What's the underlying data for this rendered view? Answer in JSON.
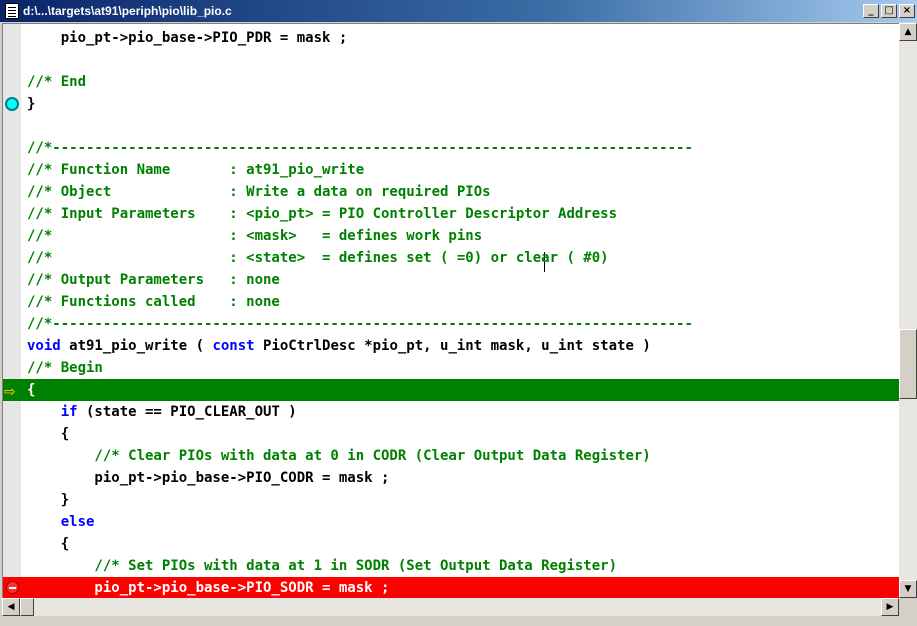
{
  "window": {
    "title": "d:\\...\\targets\\at91\\periph\\pio\\lib_pio.c"
  },
  "titlebar_buttons": {
    "minimize": "_",
    "maximize": "□",
    "close": "×"
  },
  "editor": {
    "lines": [
      {
        "text": "    pio_pt->pio_base->PIO_PDR = mask ;",
        "style": "code"
      },
      {
        "text": "",
        "style": "code"
      },
      {
        "text": "//* End",
        "style": "comment"
      },
      {
        "text": "}",
        "style": "code",
        "marker": "circle"
      },
      {
        "text": "",
        "style": "code"
      },
      {
        "text": "//*----------------------------------------------------------------------------",
        "style": "comment"
      },
      {
        "text": "//* Function Name       : at91_pio_write",
        "style": "comment"
      },
      {
        "text": "//* Object              : Write a data on required PIOs",
        "style": "comment"
      },
      {
        "text": "//* Input Parameters    : <pio_pt> = PIO Controller Descriptor Address",
        "style": "comment"
      },
      {
        "text": "//*                     : <mask>   = defines work pins",
        "style": "comment"
      },
      {
        "text": "//*                     : <state>  = defines set ( =0) or clear ( #0)",
        "style": "comment"
      },
      {
        "text": "//* Output Parameters   : none",
        "style": "comment"
      },
      {
        "text": "//* Functions called    : none",
        "style": "comment"
      },
      {
        "text": "//*----------------------------------------------------------------------------",
        "style": "comment"
      },
      {
        "segments": [
          {
            "t": "void",
            "s": "kw"
          },
          {
            "t": " at91_pio_write ( ",
            "s": "code"
          },
          {
            "t": "const",
            "s": "kw"
          },
          {
            "t": " PioCtrlDesc *pio_pt, u_int mask, u_int state )",
            "s": "code"
          }
        ]
      },
      {
        "text": "//* Begin",
        "style": "comment"
      },
      {
        "text": "{",
        "style": "code",
        "highlight": "green",
        "marker": "arrow"
      },
      {
        "segments": [
          {
            "t": "    if",
            "s": "kw"
          },
          {
            "t": " (state == PIO_CLEAR_OUT )",
            "s": "code"
          }
        ]
      },
      {
        "text": "    {",
        "style": "code"
      },
      {
        "text": "        //* Clear PIOs with data at 0 in CODR (Clear Output Data Register)",
        "style": "comment"
      },
      {
        "text": "        pio_pt->pio_base->PIO_CODR = mask ;",
        "style": "code"
      },
      {
        "text": "    }",
        "style": "code"
      },
      {
        "text": "    else",
        "style": "kw"
      },
      {
        "text": "    {",
        "style": "code"
      },
      {
        "text": "        //* Set PIOs with data at 1 in SODR (Set Output Data Register)",
        "style": "comment"
      },
      {
        "text": "        pio_pt->pio_base->PIO_SODR = mask ;",
        "style": "code",
        "highlight": "red",
        "marker": "breakpoint"
      },
      {
        "text": "    }",
        "style": "code"
      }
    ]
  },
  "scrollbar": {
    "up": "▲",
    "down": "▼",
    "left": "◀",
    "right": "▶"
  }
}
